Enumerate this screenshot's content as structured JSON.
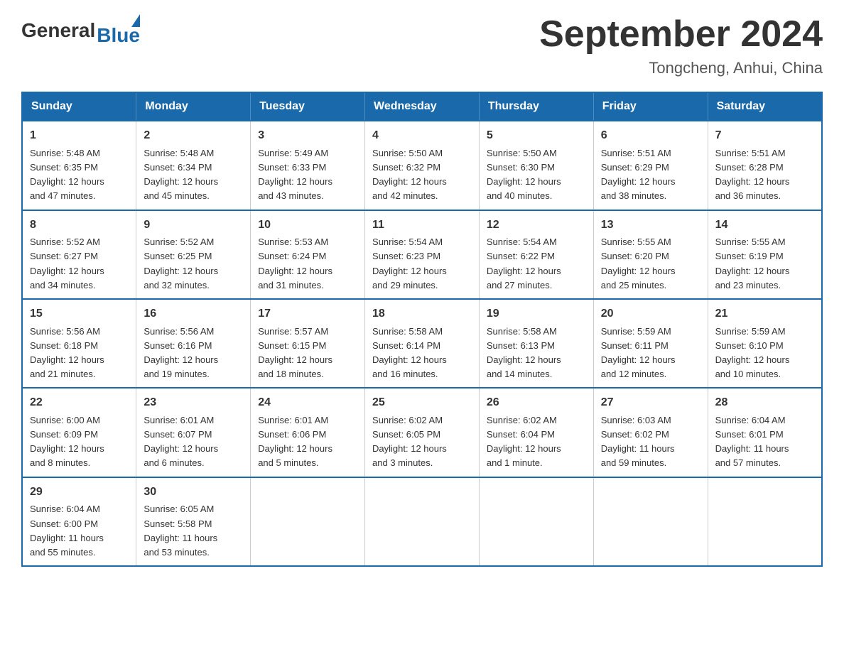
{
  "logo": {
    "general": "General",
    "blue": "Blue"
  },
  "header": {
    "title": "September 2024",
    "subtitle": "Tongcheng, Anhui, China"
  },
  "days_of_week": [
    "Sunday",
    "Monday",
    "Tuesday",
    "Wednesday",
    "Thursday",
    "Friday",
    "Saturday"
  ],
  "weeks": [
    [
      {
        "day": "1",
        "sunrise": "5:48 AM",
        "sunset": "6:35 PM",
        "daylight": "12 hours and 47 minutes."
      },
      {
        "day": "2",
        "sunrise": "5:48 AM",
        "sunset": "6:34 PM",
        "daylight": "12 hours and 45 minutes."
      },
      {
        "day": "3",
        "sunrise": "5:49 AM",
        "sunset": "6:33 PM",
        "daylight": "12 hours and 43 minutes."
      },
      {
        "day": "4",
        "sunrise": "5:50 AM",
        "sunset": "6:32 PM",
        "daylight": "12 hours and 42 minutes."
      },
      {
        "day": "5",
        "sunrise": "5:50 AM",
        "sunset": "6:30 PM",
        "daylight": "12 hours and 40 minutes."
      },
      {
        "day": "6",
        "sunrise": "5:51 AM",
        "sunset": "6:29 PM",
        "daylight": "12 hours and 38 minutes."
      },
      {
        "day": "7",
        "sunrise": "5:51 AM",
        "sunset": "6:28 PM",
        "daylight": "12 hours and 36 minutes."
      }
    ],
    [
      {
        "day": "8",
        "sunrise": "5:52 AM",
        "sunset": "6:27 PM",
        "daylight": "12 hours and 34 minutes."
      },
      {
        "day": "9",
        "sunrise": "5:52 AM",
        "sunset": "6:25 PM",
        "daylight": "12 hours and 32 minutes."
      },
      {
        "day": "10",
        "sunrise": "5:53 AM",
        "sunset": "6:24 PM",
        "daylight": "12 hours and 31 minutes."
      },
      {
        "day": "11",
        "sunrise": "5:54 AM",
        "sunset": "6:23 PM",
        "daylight": "12 hours and 29 minutes."
      },
      {
        "day": "12",
        "sunrise": "5:54 AM",
        "sunset": "6:22 PM",
        "daylight": "12 hours and 27 minutes."
      },
      {
        "day": "13",
        "sunrise": "5:55 AM",
        "sunset": "6:20 PM",
        "daylight": "12 hours and 25 minutes."
      },
      {
        "day": "14",
        "sunrise": "5:55 AM",
        "sunset": "6:19 PM",
        "daylight": "12 hours and 23 minutes."
      }
    ],
    [
      {
        "day": "15",
        "sunrise": "5:56 AM",
        "sunset": "6:18 PM",
        "daylight": "12 hours and 21 minutes."
      },
      {
        "day": "16",
        "sunrise": "5:56 AM",
        "sunset": "6:16 PM",
        "daylight": "12 hours and 19 minutes."
      },
      {
        "day": "17",
        "sunrise": "5:57 AM",
        "sunset": "6:15 PM",
        "daylight": "12 hours and 18 minutes."
      },
      {
        "day": "18",
        "sunrise": "5:58 AM",
        "sunset": "6:14 PM",
        "daylight": "12 hours and 16 minutes."
      },
      {
        "day": "19",
        "sunrise": "5:58 AM",
        "sunset": "6:13 PM",
        "daylight": "12 hours and 14 minutes."
      },
      {
        "day": "20",
        "sunrise": "5:59 AM",
        "sunset": "6:11 PM",
        "daylight": "12 hours and 12 minutes."
      },
      {
        "day": "21",
        "sunrise": "5:59 AM",
        "sunset": "6:10 PM",
        "daylight": "12 hours and 10 minutes."
      }
    ],
    [
      {
        "day": "22",
        "sunrise": "6:00 AM",
        "sunset": "6:09 PM",
        "daylight": "12 hours and 8 minutes."
      },
      {
        "day": "23",
        "sunrise": "6:01 AM",
        "sunset": "6:07 PM",
        "daylight": "12 hours and 6 minutes."
      },
      {
        "day": "24",
        "sunrise": "6:01 AM",
        "sunset": "6:06 PM",
        "daylight": "12 hours and 5 minutes."
      },
      {
        "day": "25",
        "sunrise": "6:02 AM",
        "sunset": "6:05 PM",
        "daylight": "12 hours and 3 minutes."
      },
      {
        "day": "26",
        "sunrise": "6:02 AM",
        "sunset": "6:04 PM",
        "daylight": "12 hours and 1 minute."
      },
      {
        "day": "27",
        "sunrise": "6:03 AM",
        "sunset": "6:02 PM",
        "daylight": "11 hours and 59 minutes."
      },
      {
        "day": "28",
        "sunrise": "6:04 AM",
        "sunset": "6:01 PM",
        "daylight": "11 hours and 57 minutes."
      }
    ],
    [
      {
        "day": "29",
        "sunrise": "6:04 AM",
        "sunset": "6:00 PM",
        "daylight": "11 hours and 55 minutes."
      },
      {
        "day": "30",
        "sunrise": "6:05 AM",
        "sunset": "5:58 PM",
        "daylight": "11 hours and 53 minutes."
      },
      null,
      null,
      null,
      null,
      null
    ]
  ],
  "labels": {
    "sunrise": "Sunrise:",
    "sunset": "Sunset:",
    "daylight": "Daylight:"
  }
}
